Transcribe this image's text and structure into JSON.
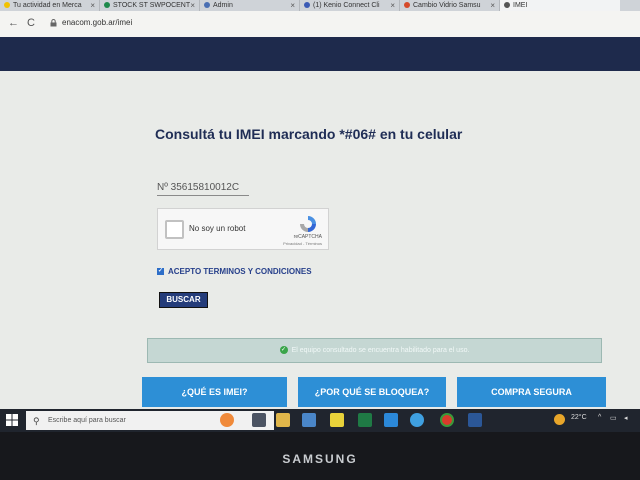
{
  "browser": {
    "tabs": [
      {
        "label": "Tu actividad en Merca"
      },
      {
        "label": "STOCK ST SWPOCENT"
      },
      {
        "label": "Admin"
      },
      {
        "label": "(1) Kenio Connect Cli"
      },
      {
        "label": "Cambio Vidrio Samsu"
      },
      {
        "label": "IMEI"
      }
    ],
    "url": "enacom.gob.ar/imei",
    "back_glyph": "←",
    "forward_glyph": "→",
    "reload_glyph": "C"
  },
  "page": {
    "title": "Consultá tu IMEI marcando *#06# en tu celular",
    "imei_value": "Nº  35615810012C",
    "captcha": {
      "label": "No soy un robot",
      "brand": "reCAPTCHA",
      "links": "Privacidad - Términos"
    },
    "terms_label": "ACEPTO TERMINOS Y CONDICIONES",
    "search_button": "BUSCAR",
    "result_message": "El equipo consultado se encuentra habilitado para el uso.",
    "buttons": {
      "what_is_imei": "¿QUÉ ES IMEI?",
      "why_blocked": "¿POR QUÉ SE BLOQUEA?",
      "safe_purchase": "COMPRA SEGURA"
    }
  },
  "taskbar": {
    "search_placeholder": "Escribe aquí para buscar",
    "temperature": "22°C"
  },
  "monitor": {
    "brand": "SAMSUNG"
  },
  "colors": {
    "header_band": "#1e2a4c",
    "title": "#1f2d55",
    "button_blue": "#2d8fd6",
    "search_button": "#243c7a",
    "success_green": "#3aa54a"
  }
}
